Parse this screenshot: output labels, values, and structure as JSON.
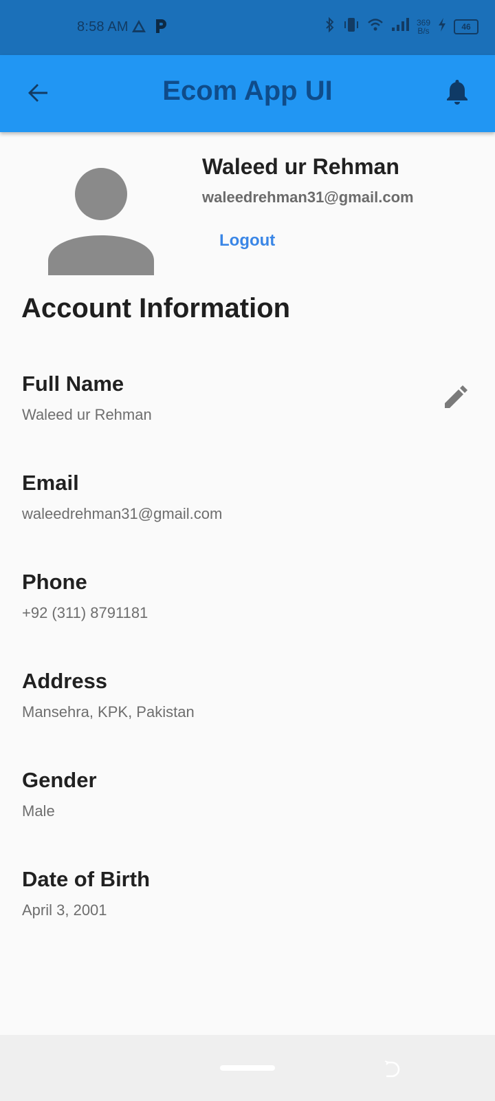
{
  "status_bar": {
    "time": "8:58 AM",
    "net_speed_value": "369",
    "net_speed_unit": "B/s",
    "battery_level": "46",
    "left_icons": [
      "triangle-icon",
      "p-app-icon"
    ],
    "right_icons": [
      "bluetooth-icon",
      "vibrate-icon",
      "wifi-icon",
      "signal-icon",
      "charging-icon",
      "battery-icon"
    ]
  },
  "app_bar": {
    "title": "Ecom App UI",
    "back_icon": "arrow-back-icon",
    "bell_icon": "notification-bell-icon",
    "background_color": "#2196f3",
    "title_color": "#0f4c8a"
  },
  "profile": {
    "name": "Waleed ur Rehman",
    "email": "waleedrehman31@gmail.com",
    "logout_label": "Logout",
    "avatar_icon": "person-avatar-icon",
    "link_color": "#3a86e6"
  },
  "account": {
    "section_title": "Account Information",
    "edit_icon": "pencil-edit-icon",
    "items": [
      {
        "label": "Full Name",
        "value": "Waleed ur Rehman"
      },
      {
        "label": "Email",
        "value": "waleedrehman31@gmail.com"
      },
      {
        "label": "Phone",
        "value": "+92 (311) 8791181"
      },
      {
        "label": "Address",
        "value": "Mansehra, KPK, Pakistan"
      },
      {
        "label": "Gender",
        "value": "Male"
      },
      {
        "label": "Date of Birth",
        "value": "April 3, 2001"
      }
    ]
  },
  "nav_bar": {
    "home_indicator": "home-pill",
    "back_gesture_icon": "back-gesture-icon"
  }
}
